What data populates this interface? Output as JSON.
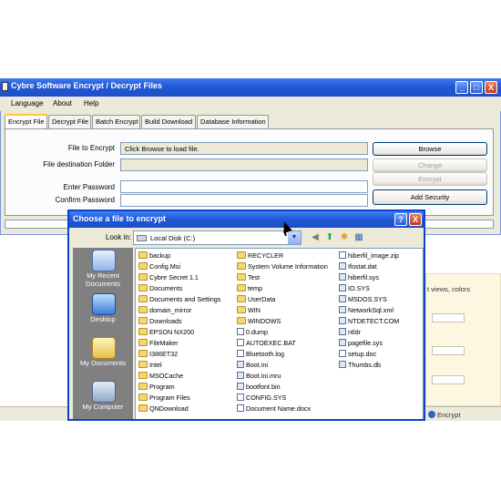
{
  "app": {
    "title": "Cybre Software Encrypt / Decrypt Files",
    "window_buttons": [
      "_",
      "□",
      "X"
    ],
    "menu": [
      "Language",
      "About",
      "Help"
    ],
    "tabs": [
      "Encrypt File",
      "Decrypt File",
      "Batch Encrypt",
      "Build Download",
      "Database Information"
    ],
    "active_tab": "Encrypt File",
    "fields": {
      "file_to_encrypt_label": "File to Encrypt",
      "file_to_encrypt_value": "Click Browse to load file.",
      "destination_label": "File destination Folder",
      "enter_password_label": "Enter Password",
      "confirm_password_label": "Confirm Password"
    },
    "buttons": {
      "browse": "Browse",
      "change": "Change",
      "encrypt": "Encrypt",
      "add_security": "Add Security"
    }
  },
  "behind_fragments": {
    "right_text": "t views, colors",
    "taskbar_item": "Encrypt"
  },
  "dialog": {
    "title": "Choose a file to encrypt",
    "help_button": "?",
    "close_button": "X",
    "look_in_label": "Look in:",
    "look_in_value": "Local Disk (C:)",
    "places": [
      "My Recent Documents",
      "Desktop",
      "My Documents",
      "My Computer"
    ],
    "columns": [
      [
        {
          "name": "backup",
          "type": "folder"
        },
        {
          "name": "Config.Msi",
          "type": "folder"
        },
        {
          "name": "Cybre Secret 1.1",
          "type": "folder"
        },
        {
          "name": "Documents",
          "type": "folder"
        },
        {
          "name": "Documents and Settings",
          "type": "folder"
        },
        {
          "name": "domain_mirror",
          "type": "folder"
        },
        {
          "name": "Downloads",
          "type": "folder"
        },
        {
          "name": "EPSON NX200",
          "type": "folder"
        },
        {
          "name": "FileMaker",
          "type": "folder"
        },
        {
          "name": "I386ET32",
          "type": "folder"
        },
        {
          "name": "Intel",
          "type": "folder"
        },
        {
          "name": "MSOCache",
          "type": "folder"
        },
        {
          "name": "Program",
          "type": "folder"
        },
        {
          "name": "Program Files",
          "type": "folder"
        },
        {
          "name": "QNDownload",
          "type": "folder"
        }
      ],
      [
        {
          "name": "RECYCLER",
          "type": "folder"
        },
        {
          "name": "System Volume Information",
          "type": "folder"
        },
        {
          "name": "Test",
          "type": "folder"
        },
        {
          "name": "temp",
          "type": "folder"
        },
        {
          "name": "UserData",
          "type": "folder"
        },
        {
          "name": "WIN",
          "type": "folder"
        },
        {
          "name": "WINDOWS",
          "type": "folder"
        },
        {
          "name": "0.dump",
          "type": "file"
        },
        {
          "name": "AUTOEXEC.BAT",
          "type": "file"
        },
        {
          "name": "Bluetooth.log",
          "type": "file"
        },
        {
          "name": "Boot.ini",
          "type": "sys"
        },
        {
          "name": "Boot.ini.mru",
          "type": "sys"
        },
        {
          "name": "bootfont.bin",
          "type": "sys"
        },
        {
          "name": "CONFIG.SYS",
          "type": "file"
        },
        {
          "name": "Document Name.docx",
          "type": "file"
        }
      ],
      [
        {
          "name": "hiberfil_image.zip",
          "type": "file"
        },
        {
          "name": "Ifostat.dat",
          "type": "sys"
        },
        {
          "name": "hiberfil.sys",
          "type": "sys"
        },
        {
          "name": "IO.SYS",
          "type": "sys"
        },
        {
          "name": "MSDOS.SYS",
          "type": "sys"
        },
        {
          "name": "NetworkSql.xml",
          "type": "sys"
        },
        {
          "name": "NTDETECT.COM",
          "type": "sys"
        },
        {
          "name": "ntldr",
          "type": "sys"
        },
        {
          "name": "pagefile.sys",
          "type": "sys"
        },
        {
          "name": "setup.doc",
          "type": "file"
        },
        {
          "name": "Thumbs.db",
          "type": "sys"
        }
      ]
    ]
  },
  "colors": {
    "title_blue": "#2357d6",
    "window_face": "#ece9d8",
    "places_bar": "#808080",
    "folder": "#f5d66f"
  }
}
